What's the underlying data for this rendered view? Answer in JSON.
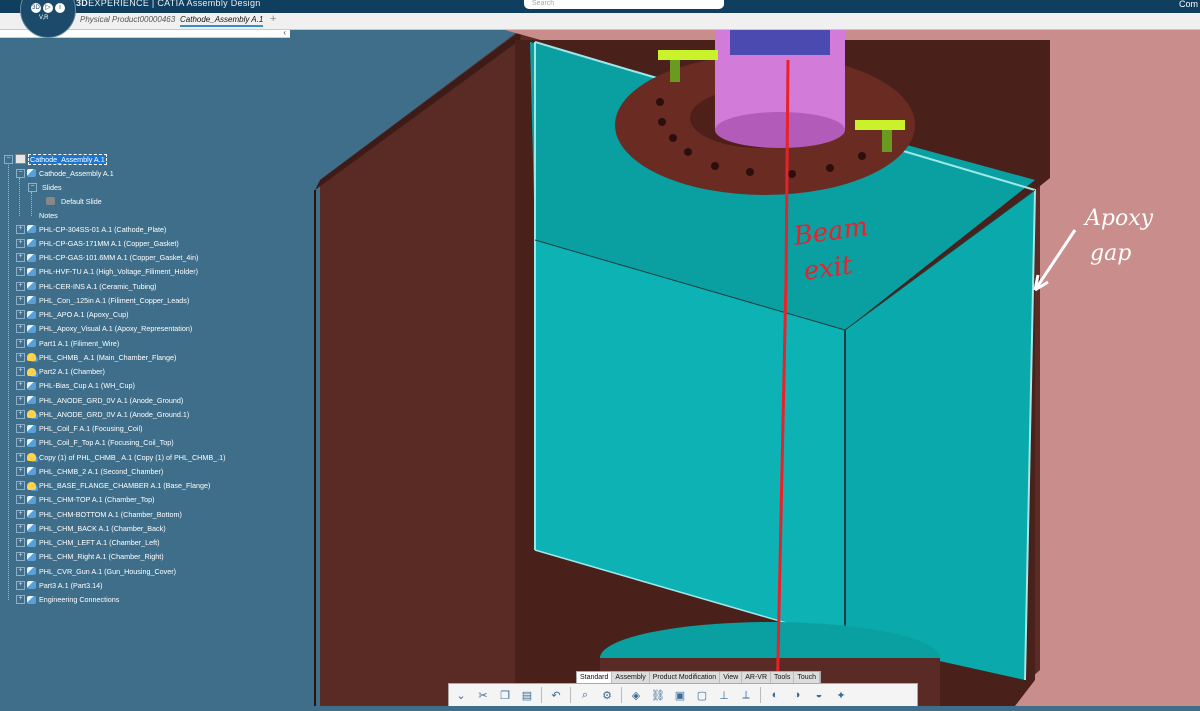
{
  "app": {
    "brand_prefix": "3D",
    "brand_name": "EXPERIENCE | CATIA",
    "app_name": "Assembly Design",
    "search_placeholder": "Search",
    "user_label": "Com"
  },
  "compass": {
    "b1": "3D",
    "b2": "▷",
    "b3": "i",
    "b4": "V,R"
  },
  "tabs": [
    {
      "label": "Physical Product00000463"
    },
    {
      "label": "Cathode_Assembly A.1"
    }
  ],
  "tabs_plus": "+",
  "tree": {
    "root": "Cathode_Assembly A.1",
    "child": "Cathode_Assembly A.1",
    "slides": "Slides",
    "default_slide": "Default Slide",
    "notes": "Notes",
    "items": [
      {
        "label": "PHL-CP-304SS-01 A.1 (Cathode_Plate)",
        "icon": "part"
      },
      {
        "label": "PHL-CP-GAS-171MM A.1 (Copper_Gasket)",
        "icon": "part"
      },
      {
        "label": "PHL-CP-GAS-101.6MM A.1 (Copper_Gasket_4in)",
        "icon": "part"
      },
      {
        "label": "PHL-HVF-TU A.1 (High_Voltage_Filiment_Holder)",
        "icon": "part"
      },
      {
        "label": "PHL-CER-INS A.1 (Ceramic_Tubing)",
        "icon": "part"
      },
      {
        "label": "PHL_Con_.125in A.1 (Filiment_Copper_Leads)",
        "icon": "part"
      },
      {
        "label": "PHL_APO A.1 (Apoxy_Cup)",
        "icon": "part"
      },
      {
        "label": "PHL_Apoxy_Visual A.1 (Apoxy_Representation)",
        "icon": "part"
      },
      {
        "label": "Part1 A.1 (Filiment_Wire)",
        "icon": "part"
      },
      {
        "label": "PHL_CHMB_ A.1 (Main_Chamber_Flange)",
        "icon": "prod"
      },
      {
        "label": "Part2 A.1 (Chamber)",
        "icon": "prod"
      },
      {
        "label": "PHL-Bias_Cup A.1 (WH_Cup)",
        "icon": "part"
      },
      {
        "label": "PHL_ANODE_GRD_0V A.1 (Anode_Ground)",
        "icon": "part"
      },
      {
        "label": "PHL_ANODE_GRD_0V A.1 (Anode_Ground.1)",
        "icon": "prod"
      },
      {
        "label": "PHL_Coil_F A.1 (Focusing_Coil)",
        "icon": "part"
      },
      {
        "label": "PHL_Coil_F_Top A.1 (Focusing_Coil_Top)",
        "icon": "part"
      },
      {
        "label": "Copy (1) of PHL_CHMB_ A.1 (Copy (1) of PHL_CHMB_.1)",
        "icon": "prod"
      },
      {
        "label": "PHL_CHMB_2 A.1 (Second_Chamber)",
        "icon": "part"
      },
      {
        "label": "PHL_BASE_FLANGE_CHAMBER A.1 (Base_Flange)",
        "icon": "prod"
      },
      {
        "label": "PHL_CHM-TOP A.1 (Chamber_Top)",
        "icon": "part"
      },
      {
        "label": "PHL_CHM-BOTTOM A.1 (Chamber_Bottom)",
        "icon": "part"
      },
      {
        "label": "PHL_CHM_BACK A.1 (Chamber_Back)",
        "icon": "part"
      },
      {
        "label": "PHL_CHM_LEFT A.1 (Chamber_Left)",
        "icon": "part"
      },
      {
        "label": "PHL_CHM_Right A.1 (Chamber_Right)",
        "icon": "part"
      },
      {
        "label": "PHL_CVR_Gun A.1 (Gun_Housing_Cover)",
        "icon": "part"
      },
      {
        "label": "Part3 A.1 (Part3.14)",
        "icon": "part"
      },
      {
        "label": "Engineering Connections",
        "icon": "part"
      }
    ]
  },
  "annotations": {
    "beam_exit_line1": "Beam",
    "beam_exit_line2": "exit",
    "apoxy_gap_line1": "Apoxy",
    "apoxy_gap_line2": "gap"
  },
  "bottom_tabs": [
    "Standard",
    "Assembly",
    "Product Modification",
    "View",
    "AR-VR",
    "Tools",
    "Touch"
  ],
  "colors": {
    "background": "#3f6e8a",
    "chamber_wall": "#5a2a24",
    "apoxy_teal": "#0cb2b4",
    "apoxy_edge": "#9fe8ea",
    "gap_pink": "#c98d8b",
    "flange": "#6a2c22",
    "tube_magenta": "#d27bd8",
    "beam_red": "#e8212b",
    "lime": "#c9f22a"
  }
}
